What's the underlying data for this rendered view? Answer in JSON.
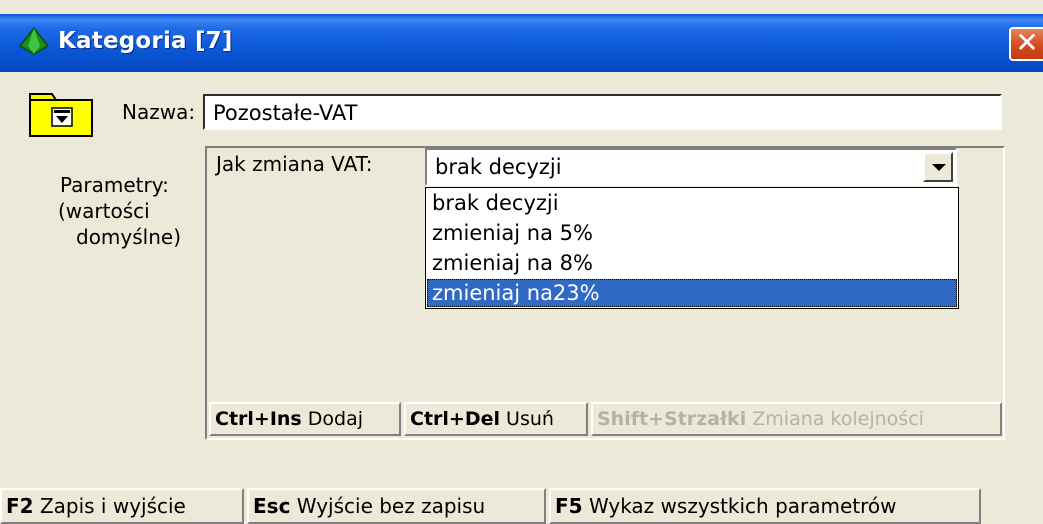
{
  "window": {
    "title": "Kategoria [7]",
    "title_icon": "green-diamond-icon",
    "close_icon": "close-icon"
  },
  "form": {
    "name_label": "Nazwa:",
    "name_value": "Pozostałe-VAT",
    "folder_icon": "folder-dropdown-icon",
    "params_label_line1": "Parametry:",
    "params_label_line2": "(wartości",
    "params_label_line3": "domyślne)"
  },
  "vat": {
    "label": "Jak zmiana VAT:",
    "selected": "brak decyzji",
    "options": [
      "brak decyzji",
      "zmieniaj na 5%",
      "zmieniaj na 8%",
      "zmieniaj na23%"
    ],
    "highlighted_index": 3
  },
  "panel_hints": [
    {
      "key": "Ctrl+Ins",
      "text": "Dodaj",
      "enabled": true
    },
    {
      "key": "Ctrl+Del",
      "text": "Usuń",
      "enabled": true
    },
    {
      "key": "Shift+Strzałki",
      "text": "Zmiana kolejności",
      "enabled": false
    }
  ],
  "footer_hints": [
    {
      "key": "F2",
      "text": "Zapis i wyjście"
    },
    {
      "key": "Esc",
      "text": "Wyjście bez zapisu"
    },
    {
      "key": "F5",
      "text": "Wykaz wszystkich parametrów"
    }
  ],
  "colors": {
    "titlebar": "#0a58d6",
    "selection": "#316ac5",
    "background": "#ece9d8"
  }
}
